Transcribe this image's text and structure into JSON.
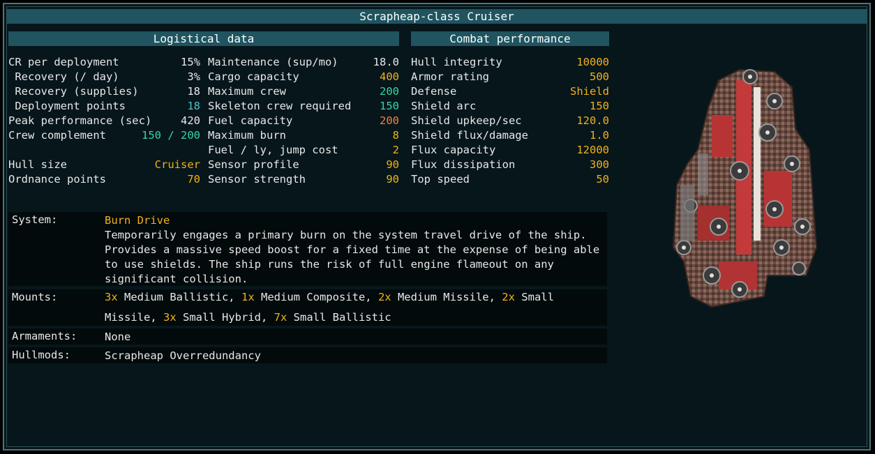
{
  "title": "Scrapheap-class Cruiser",
  "logistical": {
    "header": "Logistical data",
    "col1": [
      {
        "label": "CR per deployment",
        "value": "15%",
        "color": "#e8e8e8"
      },
      {
        "label": " Recovery (/ day)",
        "value": "3%",
        "color": "#e8e8e8"
      },
      {
        "label": " Recovery (supplies)",
        "value": "18",
        "color": "#e8e8e8"
      },
      {
        "label": " Deployment points",
        "value": "18",
        "color": "#4dc4c8"
      },
      {
        "label": "Peak performance (sec)",
        "value": "420",
        "color": "#e8e8e8"
      },
      {
        "label": "Crew complement",
        "value": "150 / 200",
        "color": "#35d6a0"
      },
      {
        "label": "",
        "value": "",
        "color": "#e8e8e8"
      },
      {
        "label": "Hull size",
        "value": "Cruiser",
        "color": "#f0b21a"
      },
      {
        "label": "Ordnance points",
        "value": "70",
        "color": "#f0b21a"
      }
    ],
    "col2": [
      {
        "label": "Maintenance (sup/mo)",
        "value": "18.0",
        "color": "#e8e8e8"
      },
      {
        "label": "Cargo capacity",
        "value": "400",
        "color": "#f0b21a"
      },
      {
        "label": "Maximum crew",
        "value": "200",
        "color": "#35d6a0"
      },
      {
        "label": "Skeleton crew required",
        "value": "150",
        "color": "#35d6a0"
      },
      {
        "label": "Fuel capacity",
        "value": "200",
        "color": "#ff7e33"
      },
      {
        "label": "Maximum burn",
        "value": "8",
        "color": "#f0b21a"
      },
      {
        "label": "Fuel / ly, jump cost",
        "value": "2",
        "color": "#f0b21a"
      },
      {
        "label": "Sensor profile",
        "value": "90",
        "color": "#f0b21a"
      },
      {
        "label": "Sensor strength",
        "value": "90",
        "color": "#f0b21a"
      }
    ]
  },
  "combat": {
    "header": "Combat performance",
    "rows": [
      {
        "label": "Hull integrity",
        "value": "10000",
        "color": "#f0b21a"
      },
      {
        "label": "Armor rating",
        "value": "500",
        "color": "#f0b21a"
      },
      {
        "label": "Defense",
        "value": "Shield",
        "color": "#f0b21a"
      },
      {
        "label": "Shield arc",
        "value": "150",
        "color": "#f0b21a"
      },
      {
        "label": "Shield upkeep/sec",
        "value": "120.0",
        "color": "#f0b21a"
      },
      {
        "label": "Shield flux/damage",
        "value": "1.0",
        "color": "#f0b21a"
      },
      {
        "label": "Flux capacity",
        "value": "12000",
        "color": "#f0b21a"
      },
      {
        "label": "Flux dissipation",
        "value": "300",
        "color": "#f0b21a"
      },
      {
        "label": "Top speed",
        "value": "50",
        "color": "#f0b21a"
      }
    ]
  },
  "system": {
    "label": "System:",
    "name": "Burn Drive",
    "description": "Temporarily engages a primary burn on the system travel drive of the ship. Provides a massive speed boost for a fixed time at the expense of being able to use shields. The ship runs the risk of full engine flameout on any significant collision."
  },
  "mounts": {
    "label": "Mounts:",
    "items": [
      {
        "count": "3x",
        "name": "Medium Ballistic"
      },
      {
        "count": "1x",
        "name": "Medium Composite"
      },
      {
        "count": "2x",
        "name": "Medium Missile"
      },
      {
        "count": "2x",
        "name": "Small Missile"
      },
      {
        "count": "3x",
        "name": "Small Hybrid"
      },
      {
        "count": "7x",
        "name": "Small Ballistic"
      }
    ]
  },
  "armaments": {
    "label": "Armaments:",
    "value": "None"
  },
  "hullmods": {
    "label": "Hullmods:",
    "value": "Scrapheap Overredundancy"
  },
  "ship_image": "ship-sprite-icon"
}
